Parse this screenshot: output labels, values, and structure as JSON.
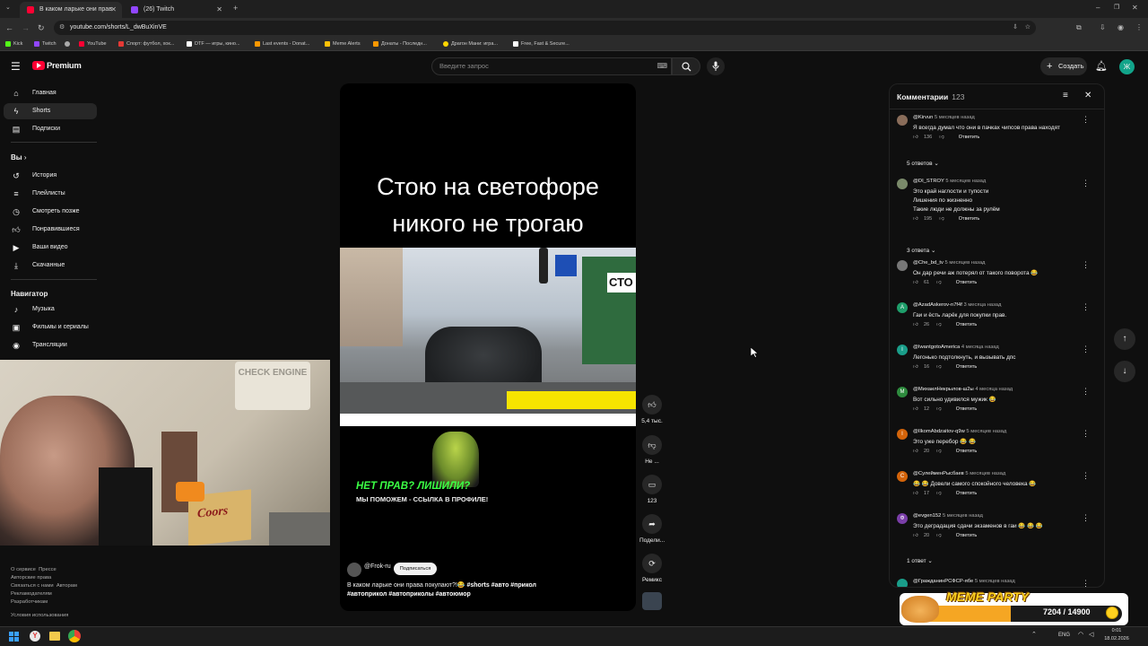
{
  "browser": {
    "tabs": [
      {
        "title": "В каком ларьке они прав",
        "active": true
      },
      {
        "title": "(26) Twitch",
        "active": false
      }
    ],
    "url": "youtube.com/shorts/L_dwBuXinVE",
    "bookmarks": [
      "Kick",
      "Twitch",
      "",
      "YouTube",
      "Спорт: футбол, хок...",
      "DTF — игры, кино...",
      "Last events - Donat...",
      "Meme Alerts",
      "Донаты - Последн...",
      "Драгон Мани: игра...",
      "Free, Fast & Secure..."
    ]
  },
  "youtube": {
    "logo": "Premium",
    "search_placeholder": "Введите запрос",
    "create_label": "Создать",
    "avatar_letter": "Ж"
  },
  "sidebar": {
    "main": [
      "Главная",
      "Shorts",
      "Подписки"
    ],
    "you_header": "Вы",
    "you_items": [
      "История",
      "Плейлисты",
      "Смотреть позже",
      "Понравившиеся",
      "Ваши видео",
      "Скачанные"
    ],
    "nav_header": "Навигатор",
    "nav_items": [
      "Музыка",
      "Фильмы и сериалы",
      "Трансляции"
    ],
    "footer1": [
      "О сервисе",
      "Прессе"
    ],
    "footer2": [
      "Авторские права"
    ],
    "footer3": [
      "Связаться с нами",
      "Авторам"
    ],
    "footer4": [
      "Рекламодателям"
    ],
    "footer5": [
      "Разработчикам"
    ],
    "footer6": [
      "Условия использования"
    ]
  },
  "video": {
    "caption_line1": "Стою на светофоре",
    "caption_line2": "никого не трогаю",
    "sign_text": "СТО",
    "promo_line1": "НЕТ ПРАВ? ЛИШИЛИ?",
    "promo_line2": "МЫ ПОМОЖЕМ - ССЫЛКА В ПРОФИЛЕ!",
    "channel": "@Frok-ru",
    "subscribe_label": "Подписаться",
    "desc_line1": "В каком ларьке они права покупают?!😂",
    "desc_tags1": "#shorts #авто #прикол",
    "desc_tags2": "#автоприкол #автоприколы #автоюмор"
  },
  "actions": {
    "likes": "5,4 тыс.",
    "dislike": "Не ...",
    "comments": "123",
    "share": "Подели...",
    "remix": "Ремикс"
  },
  "comments_panel": {
    "title": "Комментарии",
    "count": "123",
    "reply_label": "Ответить",
    "items": [
      {
        "author": "@Kirvun",
        "time": "5 месяцев назад",
        "lines": [
          "Я всегда думал что они в пачках чипсов права находят"
        ],
        "likes": "136",
        "replies": "5 ответов",
        "avatar": "",
        "color": "#8a6d5a"
      },
      {
        "author": "@DI_STROY",
        "time": "5 месяцев назад",
        "lines": [
          "Это край наглости и тупости",
          "Лишения по жизненно",
          "Такие люди не должны за рулём"
        ],
        "likes": "195",
        "replies": "3 ответа",
        "avatar": "",
        "color": "#7a8a6a"
      },
      {
        "author": "@Che_bd_tv",
        "time": "5 месяцев назад",
        "lines": [
          "Он дар речи аж потерял от такого поворота 😂"
        ],
        "likes": "61",
        "replies": "",
        "avatar": "",
        "color": "#777"
      },
      {
        "author": "@AzadAskerov-n7f4f",
        "time": "3 месяца назад",
        "lines": [
          "Гаи и ёсть ларёк для покупки прав."
        ],
        "likes": "26",
        "replies": "",
        "avatar": "A",
        "color": "#1e9e6a"
      },
      {
        "author": "@IwantgotoAmerica",
        "time": "4 месяца назад",
        "lines": [
          "Легонько подтолкнуть, и вызывать дпс"
        ],
        "likes": "16",
        "replies": "",
        "avatar": "I",
        "color": "#1a9e8a"
      },
      {
        "author": "@МихаилНекрылов-ш2ы",
        "time": "4 месяца назад",
        "lines": [
          "Вот сильно удивился мужик 😂"
        ],
        "likes": "12",
        "replies": "",
        "avatar": "M",
        "color": "#2e8b3e"
      },
      {
        "author": "@IlkomAbdzaitov-q9w",
        "time": "5 месяцев назад",
        "lines": [
          "Это уже перебор 😂 😂"
        ],
        "likes": "20",
        "replies": "",
        "avatar": "I",
        "color": "#d4640a"
      },
      {
        "author": "@СулейменРысбаев",
        "time": "5 месяцев назад",
        "lines": [
          "😂 😂 Довели самого спокойного человека 😂"
        ],
        "likes": "17",
        "replies": "",
        "avatar": "C",
        "color": "#d4640a"
      },
      {
        "author": "@evgen152",
        "time": "5 месяцев назад",
        "lines": [
          "Это деградация сдачи экзаменов в гаи 😂 😂 😂"
        ],
        "likes": "20",
        "replies": "1 ответ",
        "avatar": "Ф",
        "color": "#7a3ea8"
      },
      {
        "author": "@ГражданинРСФСР-ябе",
        "time": "5 месяцев назад",
        "lines": [
          ""
        ],
        "likes": "",
        "replies": "",
        "avatar": "",
        "color": "#1a9e8a"
      }
    ]
  },
  "overlays": {
    "meme_title": "MEME PARTY",
    "meme_progress": "7204 / 14900",
    "meme_fraction": 0.483,
    "cam_poster": "CHECK ENGINE",
    "cam_box": "Coors"
  },
  "taskbar": {
    "lang": "ENG",
    "time": "0:01",
    "date": "18.02.2026"
  }
}
